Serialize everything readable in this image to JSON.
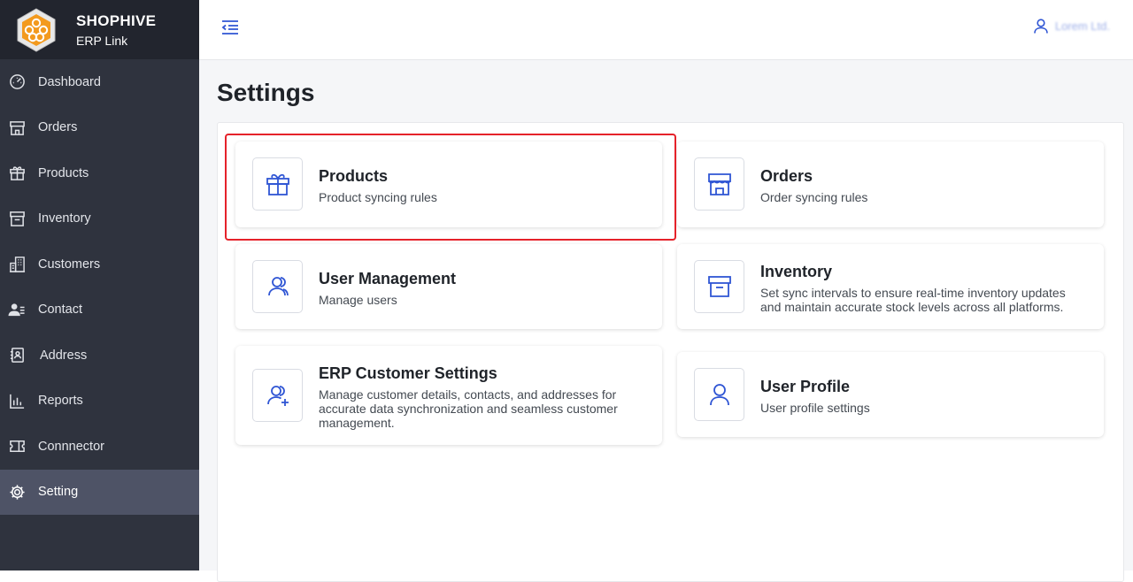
{
  "brand": {
    "name": "SHOPHIVE",
    "subtitle": "ERP Link"
  },
  "sidebar": {
    "items": [
      {
        "label": "Dashboard",
        "icon": "dashboard-icon"
      },
      {
        "label": "Orders",
        "icon": "store-icon"
      },
      {
        "label": "Products",
        "icon": "gift-icon"
      },
      {
        "label": "Inventory",
        "icon": "archive-icon"
      },
      {
        "label": "Customers",
        "icon": "buildings-icon"
      },
      {
        "label": "Contact",
        "icon": "contact-icon"
      },
      {
        "label": "Address",
        "icon": "address-book-icon"
      },
      {
        "label": "Reports",
        "icon": "bar-chart-icon"
      },
      {
        "label": "Connnector",
        "icon": "ticket-icon"
      },
      {
        "label": "Setting",
        "icon": "gear-icon",
        "active": true
      }
    ]
  },
  "header": {
    "user_name": "Lorem Ltd."
  },
  "main": {
    "page_title": "Settings",
    "cards": [
      {
        "title": "Products",
        "description": "Product syncing rules",
        "icon": "gift-icon",
        "highlighted": true
      },
      {
        "title": "Orders",
        "description": "Order syncing rules",
        "icon": "store-icon"
      },
      {
        "title": "User Management",
        "description": "Manage users",
        "icon": "users-icon"
      },
      {
        "title": "Inventory",
        "description": "Set sync intervals to ensure real-time inventory updates and maintain accurate stock levels across all platforms.",
        "icon": "archive-icon"
      },
      {
        "title": "ERP Customer Settings",
        "description": "Manage customer details, contacts, and addresses for accurate data synchronization and seamless customer management.",
        "icon": "user-add-icon"
      },
      {
        "title": "User Profile",
        "description": "User profile settings",
        "icon": "user-icon"
      }
    ]
  },
  "colors": {
    "sidebar_bg": "#2f333e",
    "brand_bg": "#22252e",
    "active_bg": "#4e5366",
    "accent_blue": "#2f55d4",
    "highlight_red": "#e5222a"
  }
}
